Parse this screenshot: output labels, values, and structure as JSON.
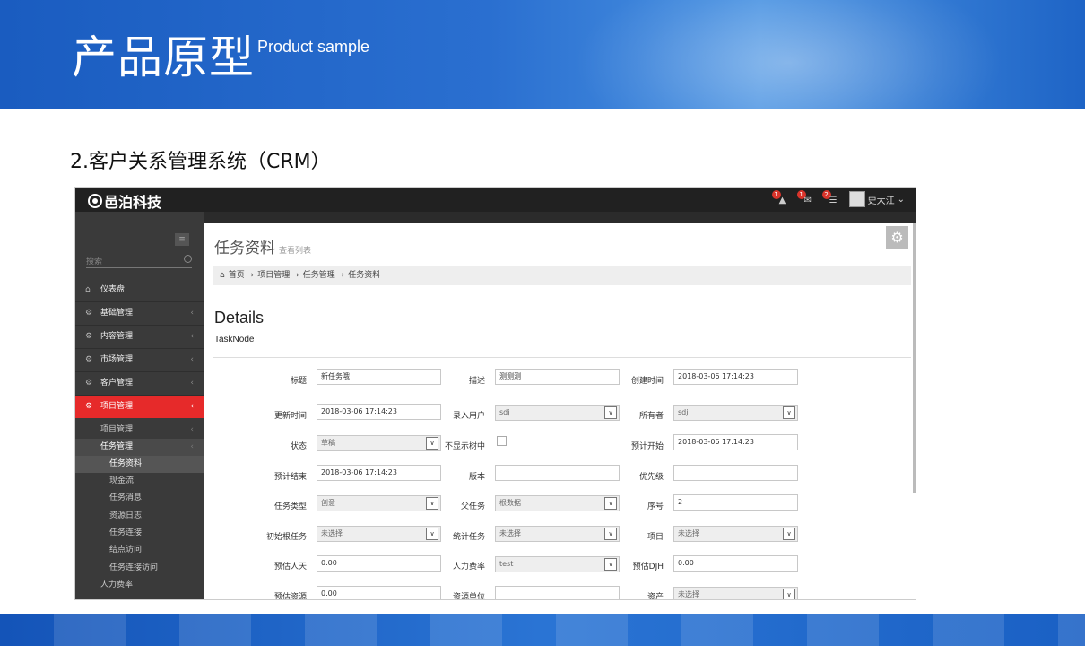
{
  "slide": {
    "title": "产品原型",
    "subtitle": "Product sample",
    "section_heading": "2.客户关系管理系统（CRM）"
  },
  "app": {
    "brand": "邑泊科技",
    "topbar": {
      "badges": [
        "1",
        "1",
        "2"
      ],
      "user_name": "史大江"
    },
    "sidebar": {
      "search_placeholder": "搜索",
      "menu": [
        {
          "label": "仪表盘",
          "icon": "dashboard-icon"
        },
        {
          "label": "基础管理",
          "icon": "cogs-icon"
        },
        {
          "label": "内容管理",
          "icon": "cogs-icon"
        },
        {
          "label": "市场管理",
          "icon": "cogs-icon"
        },
        {
          "label": "客户管理",
          "icon": "cogs-icon"
        },
        {
          "label": "项目管理",
          "icon": "cogs-icon",
          "active": true
        }
      ],
      "submenu": [
        {
          "label": "项目管理"
        },
        {
          "label": "任务管理"
        },
        {
          "label": "任务资料",
          "selected": true
        },
        {
          "label": "现金流"
        },
        {
          "label": "任务消息"
        },
        {
          "label": "资源日志"
        },
        {
          "label": "任务连接"
        },
        {
          "label": "结点访问"
        },
        {
          "label": "任务连接访问"
        },
        {
          "label": "人力费率"
        }
      ]
    },
    "page": {
      "title": "任务资料",
      "subtitle": "查看列表",
      "breadcrumb": [
        "首页",
        "项目管理",
        "任务管理",
        "任务资料"
      ],
      "details_title": "Details",
      "details_sub": "TaskNode"
    },
    "form": {
      "title_label": "标题",
      "title_value": "新任务哦",
      "desc_label": "描述",
      "desc_value": "测测测",
      "created_label": "创建时间",
      "created_value": "2018-03-06 17:14:23",
      "updated_label": "更新时间",
      "updated_value": "2018-03-06 17:14:23",
      "entry_user_label": "录入用户",
      "entry_user_value": "sdj",
      "owner_label": "所有者",
      "owner_value": "sdj",
      "status_label": "状态",
      "status_value": "草稿",
      "hide_tree_label": "不显示树中",
      "plan_start_label": "预计开始",
      "plan_start_value": "2018-03-06 17:14:23",
      "plan_end_label": "预计结束",
      "plan_end_value": "2018-03-06 17:14:23",
      "version_label": "版本",
      "version_value": "",
      "priority_label": "优先级",
      "priority_value": "",
      "task_type_label": "任务类型",
      "task_type_value": "创意",
      "parent_task_label": "父任务",
      "parent_task_value": "根数据",
      "seq_label": "序号",
      "seq_value": "2",
      "init_root_label": "初始根任务",
      "init_root_value": "未选择",
      "stat_task_label": "统计任务",
      "stat_task_value": "未选择",
      "project_label": "项目",
      "project_value": "未选择",
      "est_days_label": "预估人天",
      "est_days_value": "0.00",
      "labor_rate_label": "人力费率",
      "labor_rate_value": "test",
      "est_djh_label": "预估DJH",
      "est_djh_value": "0.00",
      "est_res_label": "预估资源",
      "est_res_value": "0.00",
      "res_unit_label": "资源单位",
      "res_unit_value": "",
      "asset_label": "资产",
      "asset_value": "未选择"
    }
  }
}
